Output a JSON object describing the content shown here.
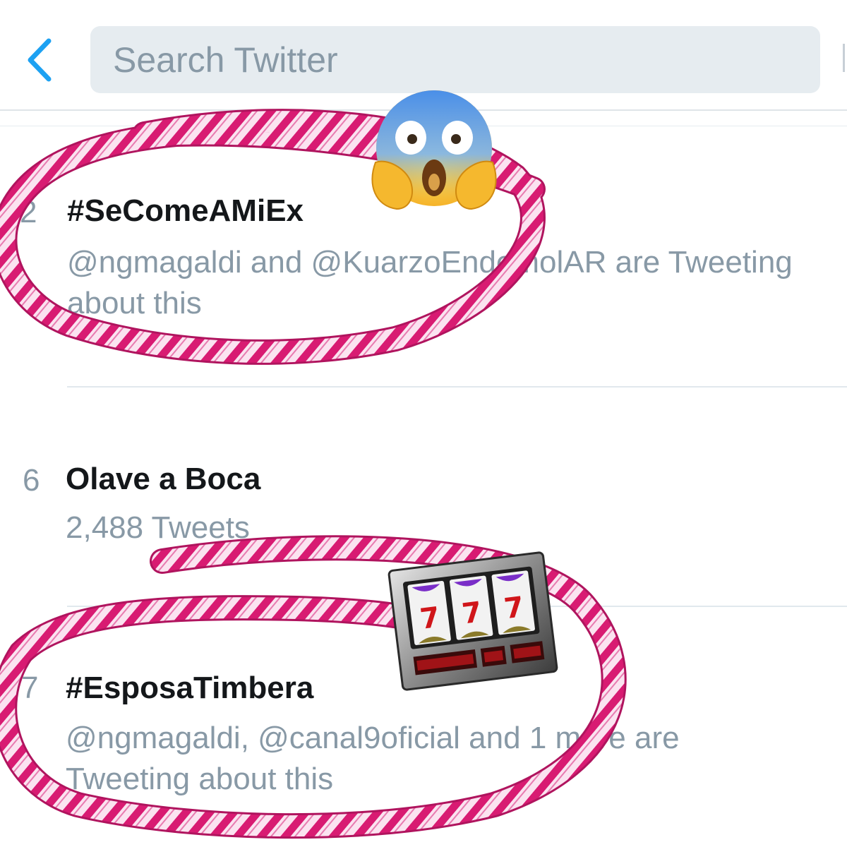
{
  "search": {
    "placeholder": "Search Twitter"
  },
  "icons": {
    "back": "chevron-left-icon",
    "emoji_1": "screaming-face-emoji",
    "emoji_2": "slot-machine-emoji"
  },
  "colors": {
    "accent": "#1da1f2",
    "candy_stripe": "#d81b72",
    "candy_base": "#fbe3f0",
    "muted_text": "#8899a6",
    "primary_text": "#14171a"
  },
  "trends": [
    {
      "rank": "2",
      "title": "#SeComeAMiEx",
      "subtitle_line1": "@ngmagaldi and @KuarzoEndemolAR are Tweeting",
      "subtitle_line2": "about this"
    },
    {
      "rank": "6",
      "title": "Olave a Boca",
      "subtitle_line1": "2,488 Tweets",
      "subtitle_line2": ""
    },
    {
      "rank": "7",
      "title": "#EsposaTimbera",
      "subtitle_line1": "@ngmagaldi, @canal9oficial and 1 more are",
      "subtitle_line2": "Tweeting about this"
    }
  ]
}
